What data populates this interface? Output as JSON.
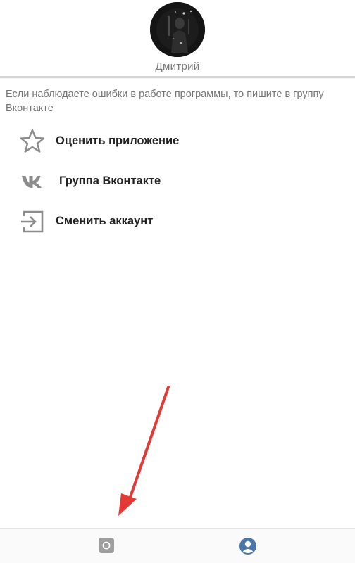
{
  "profile": {
    "name": "Дмитрий",
    "avatar_icon": "user-photo"
  },
  "notice": {
    "text": "Если наблюдаете ошибки в работе программы, то пишите в группу Вконтакте"
  },
  "menu": {
    "items": [
      {
        "label": "Оценить приложение",
        "icon": "star-icon"
      },
      {
        "label": "Группа Вконтакте",
        "icon": "vk-icon"
      },
      {
        "label": "Сменить аккаунт",
        "icon": "logout-icon"
      }
    ]
  },
  "bottom_nav": {
    "items": [
      {
        "icon": "home-icon",
        "active": false
      },
      {
        "icon": "profile-icon",
        "active": true
      }
    ]
  },
  "colors": {
    "accent": "#4a76a8",
    "icon_gray": "#8c8c8c",
    "annotation_arrow": "#e53935"
  }
}
